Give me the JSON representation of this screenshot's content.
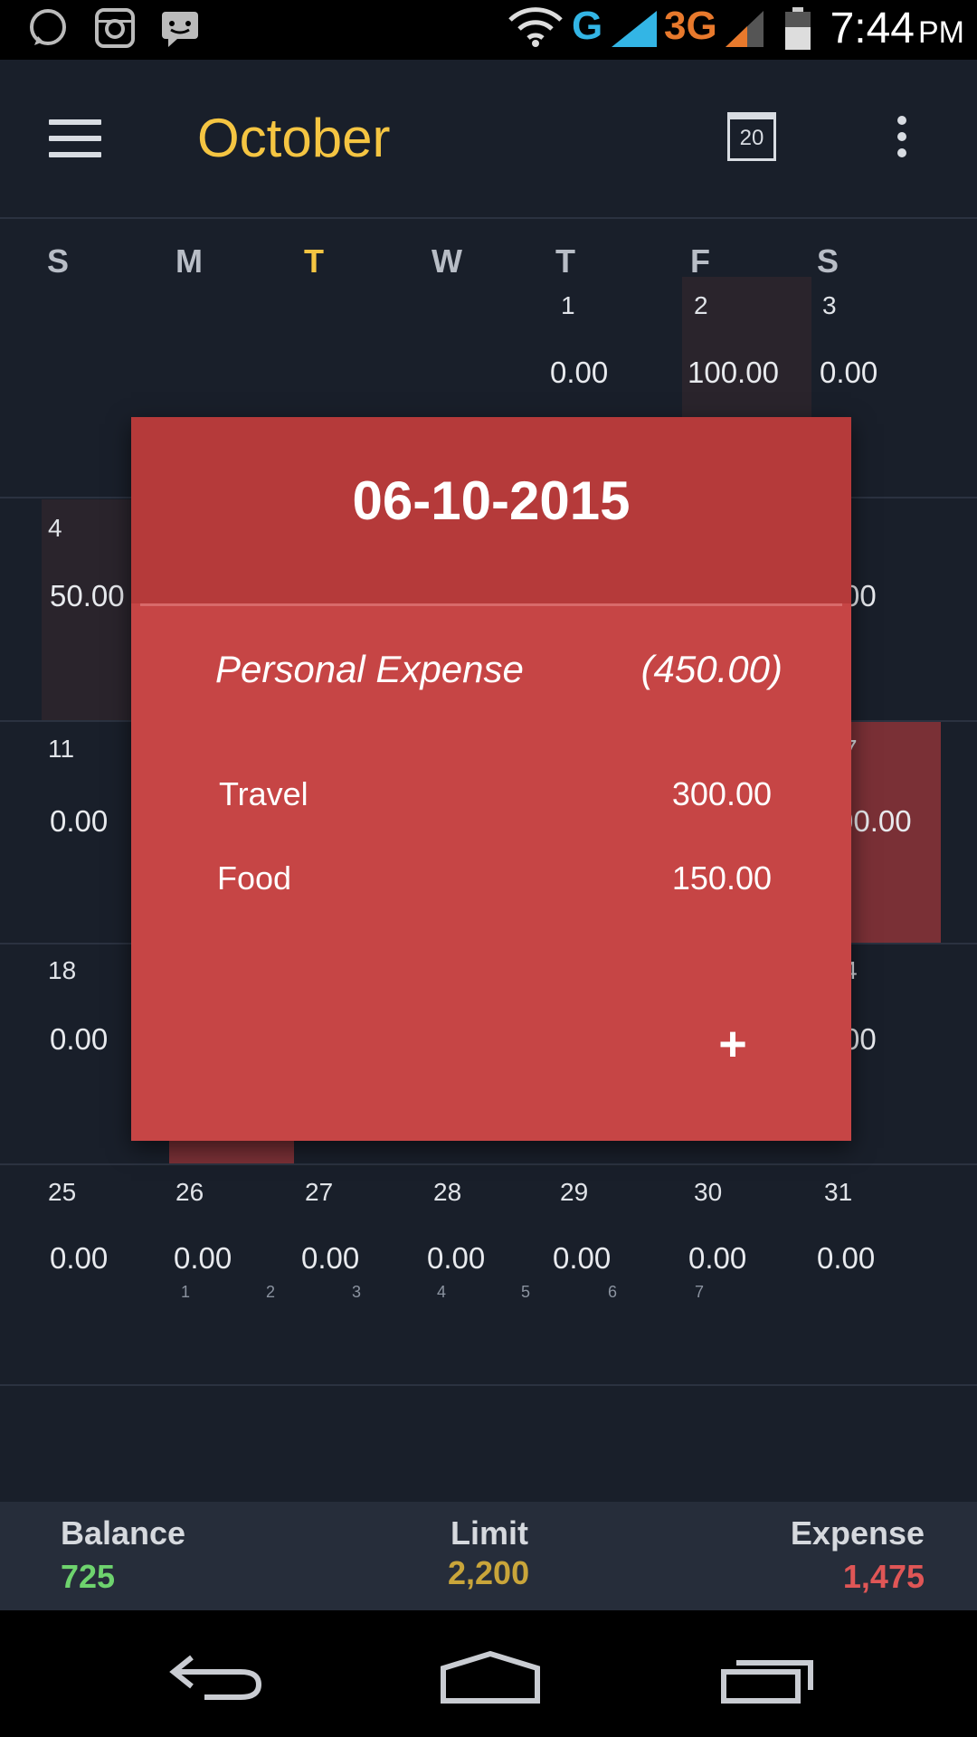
{
  "status_bar": {
    "network_g": "G",
    "network_3g": "3G",
    "time": "7:44",
    "ampm": "PM"
  },
  "header": {
    "title": "October",
    "calendar_day": "20"
  },
  "weekdays": [
    "S",
    "M",
    "T",
    "W",
    "T",
    "F",
    "S"
  ],
  "calendar": {
    "week1": {
      "d1": "1",
      "a1": "0.00",
      "d2": "2",
      "a2": "100.00",
      "d3": "3",
      "a3": "0.00"
    },
    "week2": {
      "d4": "4",
      "a4": "50.00",
      "partial_right_num": ")",
      "partial_right_amt": "00"
    },
    "week3": {
      "d11": "11",
      "a11": "0.00",
      "partial_right_num": "7",
      "partial_right_amt": "00.00"
    },
    "week4": {
      "d18": "18",
      "a18": "0.00",
      "partial_right_num": "4",
      "partial_right_amt": "00"
    },
    "week5": {
      "days": [
        "25",
        "26",
        "27",
        "28",
        "29",
        "30",
        "31"
      ],
      "amounts": [
        "0.00",
        "0.00",
        "0.00",
        "0.00",
        "0.00",
        "0.00",
        "0.00"
      ]
    },
    "week_numbers": [
      "1",
      "2",
      "3",
      "4",
      "5",
      "6",
      "7"
    ]
  },
  "dialog": {
    "date": "06-10-2015",
    "category": "Personal Expense",
    "category_total": "(450.00)",
    "items": [
      {
        "name": "Travel",
        "amount": "300.00"
      },
      {
        "name": "Food",
        "amount": "150.00"
      }
    ],
    "add_label": "+"
  },
  "summary": {
    "balance_label": "Balance",
    "balance_value": "725",
    "limit_label": "Limit",
    "limit_value": "2,200",
    "expense_label": "Expense",
    "expense_value": "1,475"
  },
  "colors": {
    "accent": "#f5c542",
    "balance": "#6ed36e",
    "limit": "#c9a53a",
    "expense": "#e05656",
    "dialog": "#c64545"
  }
}
